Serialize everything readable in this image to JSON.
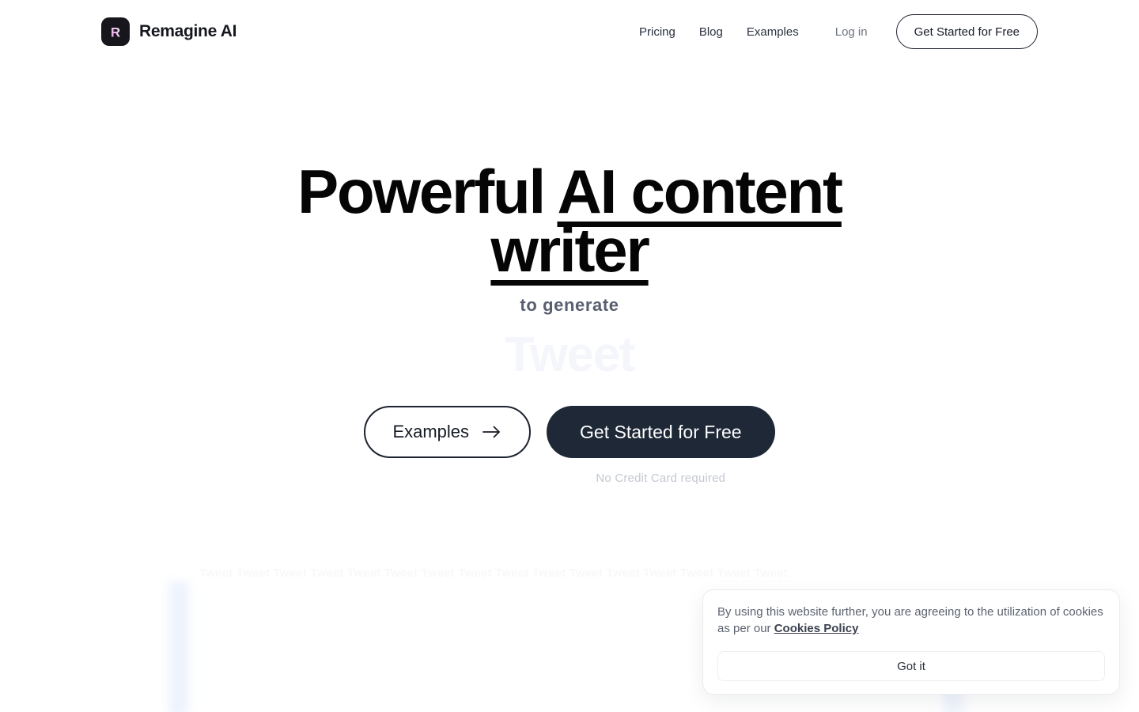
{
  "header": {
    "brand_name": "Remagine AI",
    "brand_mark_letter": "R",
    "nav": [
      {
        "label": "Pricing"
      },
      {
        "label": "Blog"
      },
      {
        "label": "Examples"
      }
    ],
    "login_label": "Log in",
    "cta_label": "Get Started for Free"
  },
  "hero": {
    "title_plain": "Powerful ",
    "title_underlined": "AI content writer",
    "subtitle": "to generate",
    "rotating_word": "Tweet",
    "examples_button": "Examples",
    "examples_arrow": "→",
    "primary_button": "Get Started for Free",
    "note": "No Credit Card required"
  },
  "ticker": {
    "ghost_text": "Tweet  Tweet  Tweet  Tweet  Tweet  Tweet  Tweet  Tweet  Tweet  Tweet  Tweet  Tweet  Tweet  Tweet  Tweet  Tweet"
  },
  "cookie_banner": {
    "text_before_link": "By using this website further, you are agreeing to the utilization of cookies as per our ",
    "link_label": "Cookies Policy",
    "accept_label": "Got it"
  },
  "colors": {
    "text_dark": "#1e2430",
    "text_muted": "#6d7382",
    "primary_button_bg": "#1e2836",
    "note_gray": "#c3c8d1",
    "brand_mark_bg": "#17161c",
    "brand_mark_letter": "#f0b9ee",
    "rotator_faded": "#f4f6fb"
  }
}
